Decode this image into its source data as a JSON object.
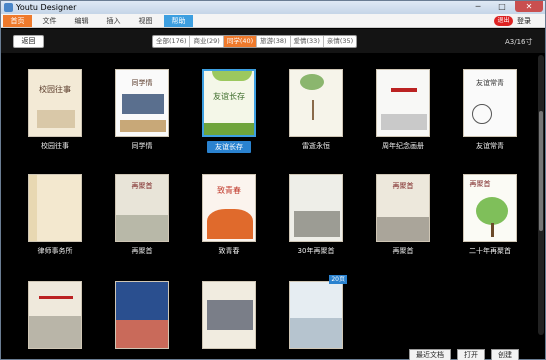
{
  "window": {
    "title": "Youtu Designer",
    "minimize_glyph": "─",
    "maximize_glyph": "□",
    "close_glyph": "✕"
  },
  "menu": {
    "items": [
      "首页",
      "文件",
      "编辑",
      "插入",
      "视图",
      "帮助"
    ],
    "login_badge": "退出",
    "login_link": "登录"
  },
  "toolbar": {
    "back_label": "返回",
    "filters": [
      "全部(176)",
      "商业(29)",
      "同学(40)",
      "旅游(38)",
      "爱情(33)",
      "亲情(35)"
    ],
    "active_filter": "同学(40)",
    "page_indicator": "A3/16寸"
  },
  "templates": [
    {
      "name": "校园往事",
      "cover_title": "校园往事",
      "selected": false
    },
    {
      "name": "同学情",
      "cover_title": "同学情",
      "selected": false
    },
    {
      "name": "友谊长存",
      "cover_title": "友谊长存",
      "selected": true
    },
    {
      "name": "雷逝永恒",
      "cover_title": "",
      "selected": false
    },
    {
      "name": "周年纪念画册",
      "cover_title": "",
      "selected": false
    },
    {
      "name": "友谊常青",
      "cover_title": "友谊常青",
      "selected": false
    },
    {
      "name": "律师事务所",
      "cover_title": "",
      "selected": false
    },
    {
      "name": "再聚首",
      "cover_title": "再聚首",
      "selected": false
    },
    {
      "name": "致青春",
      "cover_title": "致青春",
      "selected": false
    },
    {
      "name": "30年再聚首",
      "cover_title": "",
      "selected": false
    },
    {
      "name": "再聚首",
      "cover_title": "再聚首",
      "selected": false
    },
    {
      "name": "二十年再聚首",
      "cover_title": "再聚首",
      "selected": false
    },
    {
      "name": "",
      "cover_title": "",
      "selected": false
    },
    {
      "name": "",
      "cover_title": "",
      "selected": false
    },
    {
      "name": "",
      "cover_title": "",
      "selected": false
    },
    {
      "name": "",
      "cover_title": "",
      "selected": false,
      "badge": "20页"
    }
  ],
  "footer": {
    "buttons": [
      "最近文档",
      "打开",
      "创建"
    ]
  },
  "colors": {
    "accent_orange": "#ef7a2c",
    "accent_blue": "#2a82cf",
    "background": "#000000"
  }
}
